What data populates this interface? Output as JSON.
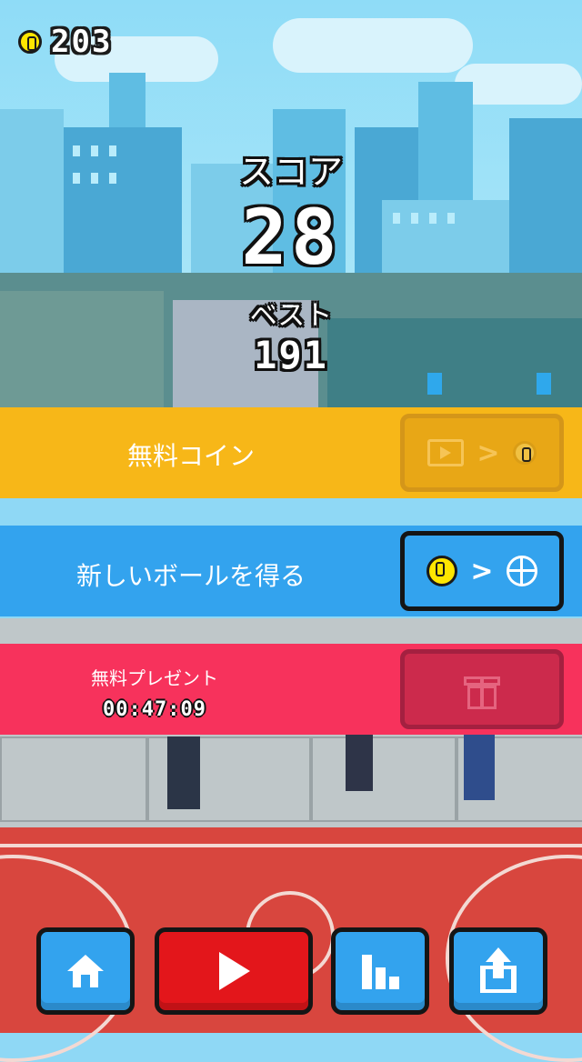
{
  "hud": {
    "coins": "203",
    "coin_icon": "coin-icon"
  },
  "score": {
    "label": "スコア",
    "value": "28"
  },
  "best": {
    "label": "ベスト",
    "value": "191"
  },
  "banners": {
    "free_coin": {
      "label": "無料コイン",
      "icons": [
        "video-icon",
        "chevron-right-icon",
        "coin-icon"
      ],
      "enabled": false
    },
    "new_ball": {
      "label": "新しいボールを得る",
      "icons": [
        "coin-icon",
        "chevron-right-icon",
        "ball-icon"
      ],
      "enabled": true
    },
    "free_gift": {
      "label": "無料プレゼント",
      "timer": "00:47:09",
      "icons": [
        "gift-icon"
      ],
      "enabled": false
    }
  },
  "bottom_buttons": [
    {
      "name": "home-button",
      "icon": "home-icon"
    },
    {
      "name": "play-button",
      "icon": "play-icon"
    },
    {
      "name": "leaderboard-button",
      "icon": "bar-chart-icon"
    },
    {
      "name": "share-button",
      "icon": "share-icon"
    }
  ],
  "colors": {
    "free_coin_banner": "#f7b718",
    "new_ball_banner": "#33a3ee",
    "free_gift_banner": "#f7325c",
    "play_button": "#e3161b",
    "coin": "#ffe600"
  }
}
